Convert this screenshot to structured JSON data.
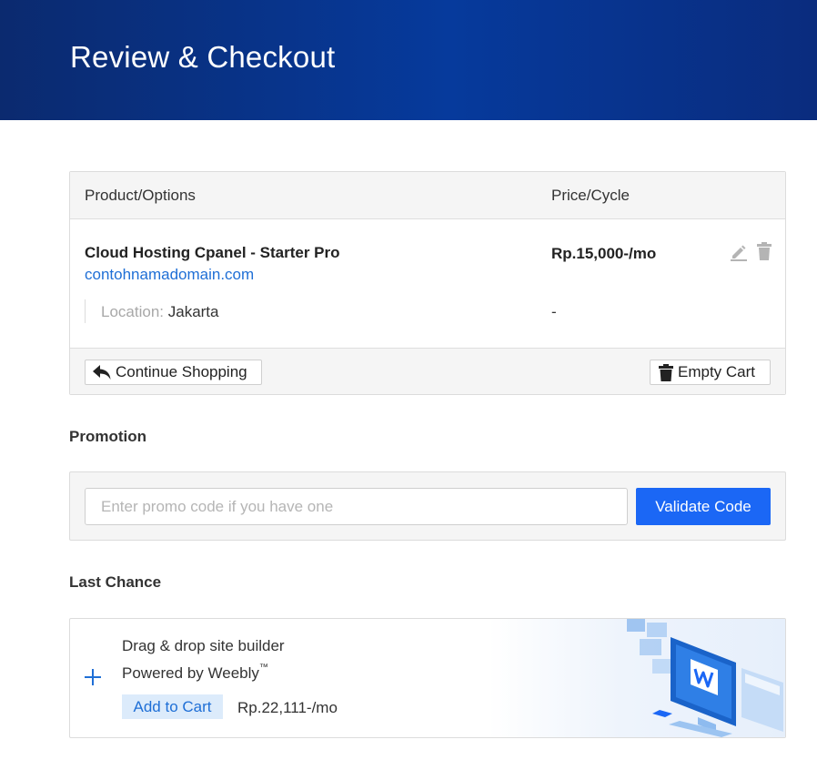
{
  "header": {
    "title": "Review & Checkout"
  },
  "cart": {
    "columns": {
      "product": "Product/Options",
      "price": "Price/Cycle"
    },
    "item": {
      "name": "Cloud Hosting Cpanel - Starter Pro",
      "domain": "contohnamadomain.com",
      "location_label": "Location:",
      "location_value": "Jakarta",
      "price": "Rp.15,000-/mo",
      "location_price": "-"
    },
    "continue_label": "Continue Shopping",
    "empty_label": "Empty Cart"
  },
  "promotion": {
    "title": "Promotion",
    "placeholder": "Enter promo code if you have one",
    "value": "",
    "validate_label": "Validate Code"
  },
  "last_chance": {
    "title": "Last Chance",
    "line1": "Drag & drop site builder",
    "line2": "Powered by Weebly",
    "trademark": "™",
    "add_label": "Add to Cart",
    "price": "Rp.22,111-/mo"
  },
  "colors": {
    "header_blue": "#063a9c",
    "accent_blue": "#1b67f5",
    "link_blue": "#1f6fd6"
  }
}
